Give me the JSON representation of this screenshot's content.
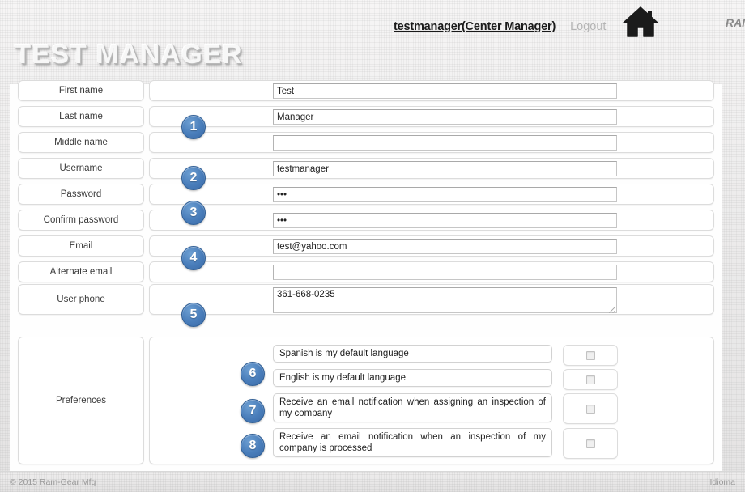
{
  "header": {
    "user_link": "testmanager(Center Manager)",
    "logout_label": "Logout",
    "home_icon": "home-icon",
    "brand_right": "RAM-GEAR",
    "page_title": "TEST MANAGER"
  },
  "form": {
    "fields": [
      {
        "label": "First name",
        "value": "Test",
        "placeholder": "",
        "badge": "",
        "type": "text"
      },
      {
        "label": "Last name",
        "value": "Manager",
        "placeholder": "",
        "badge": "1",
        "type": "text"
      },
      {
        "label": "Middle name",
        "value": "",
        "placeholder": "",
        "badge": "",
        "type": "text"
      },
      {
        "label": "Username",
        "value": "testmanager",
        "placeholder": "",
        "badge": "2",
        "type": "text"
      },
      {
        "label": "Password",
        "value": "•••",
        "placeholder": "",
        "badge": "3",
        "type": "password"
      },
      {
        "label": "Confirm password",
        "value": "•••",
        "placeholder": "",
        "badge": "",
        "type": "password"
      },
      {
        "label": "Email",
        "value": "test@yahoo.com",
        "placeholder": "",
        "badge": "4",
        "type": "text"
      },
      {
        "label": "Alternate email",
        "value": "",
        "placeholder": "",
        "badge": "",
        "type": "text"
      },
      {
        "label": "User phone",
        "value": "361-668-0235",
        "placeholder": "",
        "badge": "5",
        "type": "textarea"
      }
    ]
  },
  "preferences": {
    "label": "Preferences",
    "items": [
      {
        "text": "Spanish is my default language",
        "badge": "6",
        "checked": false
      },
      {
        "text": "English is my default language",
        "badge": "",
        "checked": false
      },
      {
        "text": "Receive an email notification when assigning an inspection of my company",
        "badge": "7",
        "checked": false
      },
      {
        "text": "Receive an email notification when an inspection of my company is processed",
        "badge": "8",
        "checked": false
      }
    ]
  },
  "footer": {
    "copyright": "© 2015 Ram-Gear Mfg",
    "language_link": "Idioma"
  },
  "colors": {
    "badge_blue": "#4a7ebb",
    "panel_white": "#fefefe",
    "muted_text": "#9a9a9a"
  }
}
